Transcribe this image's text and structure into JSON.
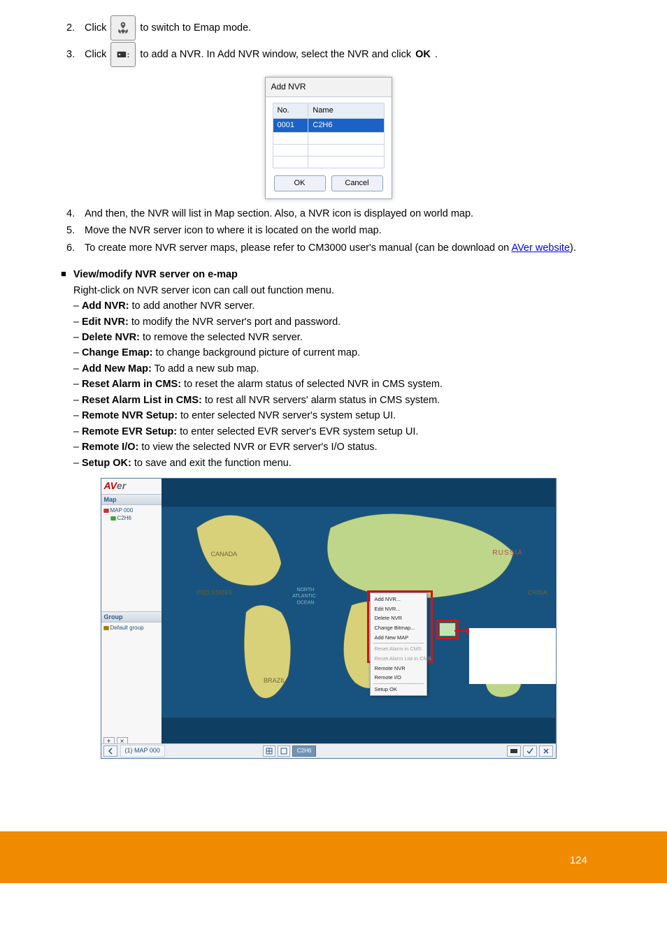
{
  "steps": {
    "s2": {
      "num": "2.",
      "a": "Click",
      "b": "to switch to Emap mode."
    },
    "s3": {
      "num": "3.",
      "a": "Click",
      "b": "to add a NVR. In Add NVR window, select the NVR and click",
      "c": "OK",
      "d": "."
    },
    "s4": {
      "num": "4.",
      "a": "And then, the NVR will list in Map section. Also, a NVR icon is displayed on world map."
    },
    "s5": {
      "num": "5.",
      "a": "Move the NVR server icon to where it is located on the world map."
    },
    "s6": {
      "num": "6.",
      "a": "To create more NVR server maps, please refer to CM3000 user's manual (can be download on",
      "link_text": "AVer website",
      "b": ")."
    }
  },
  "dlg": {
    "title": "Add NVR",
    "th_no": "No.",
    "th_name": "Name",
    "row_no": "0001",
    "row_name": "C2H6",
    "ok": "OK",
    "cancel": "Cancel"
  },
  "sect": {
    "title": "View/modify NVR server on e-map",
    "intro": "Right-click on NVR server icon can call out function menu.",
    "items": {
      "add_nvr": "**Add NVR:** to add another NVR server.",
      "edit_nvr": "**Edit NVR:** to modify the NVR server's port and password.",
      "del_nvr": "**Delete NVR:** to remove the selected NVR server.",
      "chg_emap": "**Change Emap:** to change background picture of current map.",
      "add_map": "**Add New Map:** To add a new sub map.",
      "reset_cms": "**Reset Alarm in CMS:** to reset the alarm status of selected NVR in CMS system.",
      "reset_list": "**Reset Alarm List in CMS:** to rest all NVR servers' alarm status in CMS system.",
      "remote_nvr": "**Remote NVR Setup:** to enter selected NVR server's system setup UI.",
      "remote_evr": "**Remote EVR Setup:** to enter selected EVR server's EVR system setup UI.",
      "remote_io": "**Remote I/O:** to view the selected NVR or EVR server's I/O status.",
      "setup_ok": "**Setup OK:** to save and exit the function menu."
    }
  },
  "map_panel": {
    "logo_a": "AV",
    "logo_b": "er",
    "hd_map": "Map",
    "hd_group": "Group",
    "tree_map": "MAP 000",
    "tree_nvr": "C2H6",
    "tree_group": "Default group",
    "bb_crumb": "(1) MAP 000",
    "bb_chip": "C2H6"
  },
  "ctx_menu": {
    "m1": "Add NVR...",
    "m2": "Edit NVR...",
    "m3": "Delete NVR",
    "m4": "Change Bitmap...",
    "m5": "Add New MAP",
    "m6": "Reset Alarm in CMS",
    "m7": "Reset Alarm List in CMS",
    "m8": "Remote NVR",
    "m9": "Remote I/O",
    "m10": "Setup OK"
  },
  "page_number": "124"
}
